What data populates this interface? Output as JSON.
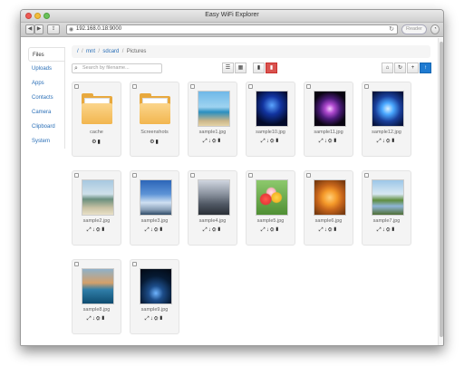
{
  "window": {
    "title": "Easy WiFi Explorer"
  },
  "browser": {
    "url": "192.168.0.18:9000",
    "reader_label": "Reader"
  },
  "sidebar": {
    "items": [
      {
        "label": "Files",
        "active": true
      },
      {
        "label": "Uploads"
      },
      {
        "label": "Apps"
      },
      {
        "label": "Contacts"
      },
      {
        "label": "Camera"
      },
      {
        "label": "Clipboard"
      },
      {
        "label": "System"
      }
    ]
  },
  "breadcrumb": {
    "root": "/",
    "items": [
      "mnt",
      "sdcard"
    ],
    "current": "Pictures"
  },
  "search": {
    "placeholder": "Search by filename..."
  },
  "toolbar": {
    "view_list_icon": "list-view-icon",
    "view_grid_icon": "grid-view-icon",
    "delete_icon": "trash-icon",
    "home_icon": "home-icon",
    "refresh_icon": "refresh-icon",
    "new_icon": "plus-icon",
    "upload_icon": "upload-icon",
    "accent_blue": "#1f7bd1",
    "accent_red": "#d9534f"
  },
  "files": [
    {
      "name": "cache",
      "type": "folder"
    },
    {
      "name": "Screenshots",
      "type": "folder"
    },
    {
      "name": "sample1.jpg",
      "type": "image"
    },
    {
      "name": "sample10.jpg",
      "type": "image"
    },
    {
      "name": "sample11.jpg",
      "type": "image"
    },
    {
      "name": "sample12.jpg",
      "type": "image"
    },
    {
      "name": "sample2.jpg",
      "type": "image"
    },
    {
      "name": "sample3.jpg",
      "type": "image"
    },
    {
      "name": "sample4.jpg",
      "type": "image"
    },
    {
      "name": "sample5.jpg",
      "type": "image"
    },
    {
      "name": "sample6.jpg",
      "type": "image"
    },
    {
      "name": "sample7.jpg",
      "type": "image"
    },
    {
      "name": "sample8.jpg",
      "type": "image"
    },
    {
      "name": "sample9.jpg",
      "type": "image"
    }
  ]
}
